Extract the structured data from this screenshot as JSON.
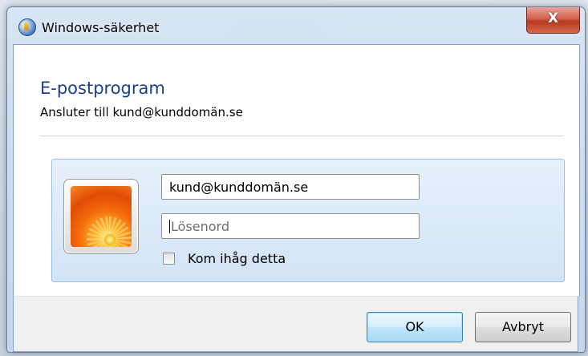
{
  "window": {
    "title": "Windows-säkerhet",
    "close_label": "X"
  },
  "dialog": {
    "heading": "E-postprogram",
    "subheading": "Ansluter till kund@kunddomän.se"
  },
  "credentials": {
    "username_value": "kund@kunddomän.se",
    "password_placeholder": "Lösenord",
    "remember_label": "Kom ihåg detta",
    "remember_checked": false
  },
  "buttons": {
    "ok_label": "OK",
    "cancel_label": "Avbryt"
  },
  "icons": {
    "window_icon": "windows-security-icon",
    "avatar": "user-avatar-flower"
  },
  "colors": {
    "heading": "#1d3f8f",
    "close_button": "#c7462c",
    "panel": "#dce9f7"
  }
}
